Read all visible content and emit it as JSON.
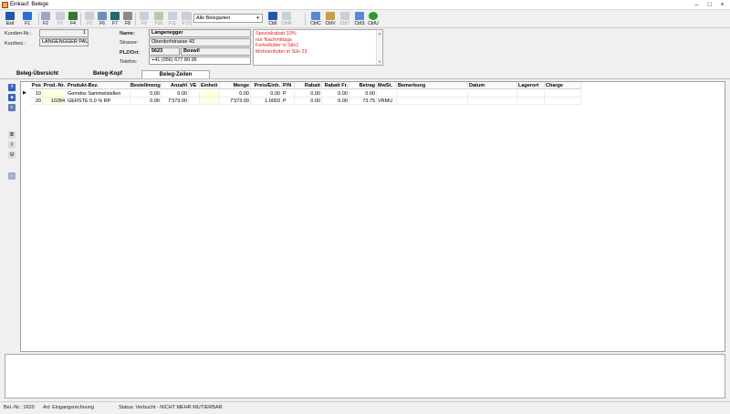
{
  "window": {
    "title": "Einkauf: Belege",
    "minimize": "–",
    "maximize": "□",
    "close": "×"
  },
  "toolbar": {
    "buttons": [
      {
        "label": "Exit",
        "color": "#1e56b0",
        "enabled": true
      },
      {
        "label": "F1",
        "color": "#2f6fd0",
        "enabled": true
      },
      {
        "label": "F2",
        "color": "#9aa8c0",
        "enabled": true
      },
      {
        "label": "F3",
        "color": "#9aa8c0",
        "enabled": false
      },
      {
        "label": "F4",
        "color": "#2f7a2f",
        "enabled": true
      },
      {
        "label": "F5",
        "color": "#9aa8c0",
        "enabled": false
      },
      {
        "label": "F6",
        "color": "#6b8fb8",
        "enabled": true
      },
      {
        "label": "F7",
        "color": "#1f6a6a",
        "enabled": true
      },
      {
        "label": "F8",
        "color": "#8a8a8a",
        "enabled": true
      },
      {
        "label": "F9",
        "color": "#9aa8c0",
        "enabled": false
      },
      {
        "label": "F10",
        "color": "#6a9a6a",
        "enabled": false
      },
      {
        "label": "F11",
        "color": "#9aa8c0",
        "enabled": false
      },
      {
        "label": "F12",
        "color": "#9aa8c0",
        "enabled": false
      }
    ],
    "filter_select": "Alle Belegarten",
    "right_buttons": [
      {
        "label": "CtrlI",
        "color": "#1e56b0",
        "enabled": true
      },
      {
        "label": "CtrlR",
        "color": "#9aa8c0",
        "enabled": false
      },
      {
        "label": "CtrlC",
        "color": "#5a8ad0",
        "enabled": true
      },
      {
        "label": "CtrlV",
        "color": "#c8a040",
        "enabled": true
      },
      {
        "label": "CtrlT",
        "color": "#9aa8c0",
        "enabled": false
      },
      {
        "label": "CtrlS",
        "color": "#5a8ad0",
        "enabled": true
      },
      {
        "label": "CtrlU",
        "color": "#2e9a2e",
        "enabled": true
      }
    ]
  },
  "customer": {
    "number_label": "Kunden-Nr.:",
    "number_value": "1",
    "short_label": "Kurzbez.:",
    "short_value": "LANGENGGER PAUL",
    "name_label": "Name:",
    "name_value": "Langenegger",
    "street_label": "Strasse:",
    "street_value": "Oberdorfstrasse 43",
    "zip_label": "PLZ/Ort:",
    "zip_value": "5623",
    "city_value": "Boswil",
    "phone_label": "Telefon:",
    "phone_value": "+41 (056) 677 80 95",
    "notes": [
      "Spezialrabatt 10%",
      "nur Nachmittags",
      "Ferkelfutter in Silo1",
      "Mohnenfutter in Silo 23"
    ]
  },
  "tabs": [
    {
      "label": "Beleg-Übersicht",
      "active": false
    },
    {
      "label": "Beleg-Kopf",
      "active": false
    },
    {
      "label": "Beleg-Zeilen",
      "active": true
    }
  ],
  "side_tools": [
    {
      "name": "zoom-tool-icon",
      "color": "#3060c0",
      "glyph": "?"
    },
    {
      "name": "record-tool-icon",
      "color": "#3060c0",
      "glyph": "■"
    },
    {
      "name": "sort-tool-icon",
      "color": "#6080b0",
      "glyph": "≡"
    },
    {
      "name": "bold-format-icon",
      "color": "#dcdcdc",
      "glyph": "B"
    },
    {
      "name": "italic-format-icon",
      "color": "#dcdcdc",
      "glyph": "I"
    },
    {
      "name": "underline-format-icon",
      "color": "#dcdcdc",
      "glyph": "U"
    },
    {
      "name": "attachment-tool-icon",
      "color": "#a0b0c8",
      "glyph": "⇔"
    }
  ],
  "grid": {
    "columns": [
      {
        "key": "pos",
        "label": "Pos"
      },
      {
        "key": "prod_nr",
        "label": "Prod.-Nr."
      },
      {
        "key": "produkt",
        "label": "Produkt-Bez."
      },
      {
        "key": "bestellmenge",
        "label": "Bestellmenge"
      },
      {
        "key": "anzahl",
        "label": "Anzahl"
      },
      {
        "key": "ve",
        "label": "VE"
      },
      {
        "key": "einheit",
        "label": "Einheit"
      },
      {
        "key": "menge",
        "label": "Menge"
      },
      {
        "key": "preis",
        "label": "Preis/Einh."
      },
      {
        "key": "pn",
        "label": "P/N"
      },
      {
        "key": "rabatt",
        "label": "Rabatt"
      },
      {
        "key": "rabatt_fr",
        "label": "Rabatt Fr."
      },
      {
        "key": "betrag",
        "label": "Betrag"
      },
      {
        "key": "mwst",
        "label": "MwSt."
      },
      {
        "key": "bemerkung",
        "label": "Bemerkung"
      },
      {
        "key": "datum",
        "label": "Datum"
      },
      {
        "key": "lagerort",
        "label": "Lagerort"
      },
      {
        "key": "charge",
        "label": "Charge"
      }
    ],
    "rows": [
      {
        "pos": "10",
        "prod_nr": "",
        "produkt": "Gemdos Sammelstellen",
        "bestellmenge": "0.00",
        "anzahl": "0.00",
        "ve": "",
        "einheit": "",
        "menge": "0.00",
        "preis": "0.00",
        "pn": "P",
        "rabatt": "0.00",
        "rabatt_fr": "0.00",
        "betrag": "0.00",
        "mwst": "",
        "bemerkung": "",
        "datum": "",
        "lagerort": "",
        "charge": "",
        "current": true
      },
      {
        "pos": "20",
        "prod_nr": "10284",
        "produkt": "GERSTE 5.0 % RP",
        "bestellmenge": "0.00",
        "anzahl": "7'373.00",
        "ve": "",
        "einheit": "",
        "menge": "7'373.00",
        "preis": "1.0003",
        "pn": "P",
        "rabatt": "0.00",
        "rabatt_fr": "0.00",
        "betrag": "73.75",
        "mwst": "VRMU",
        "bemerkung": "",
        "datum": "",
        "lagerort": "",
        "charge": "",
        "current": false
      }
    ]
  },
  "status": {
    "beleg_nr": "Bel.-Nr.: 1620",
    "art": "Art: Eingangsrechnung",
    "status": "Status: Verbucht - NICHT MEHR MUTIERBAR"
  }
}
